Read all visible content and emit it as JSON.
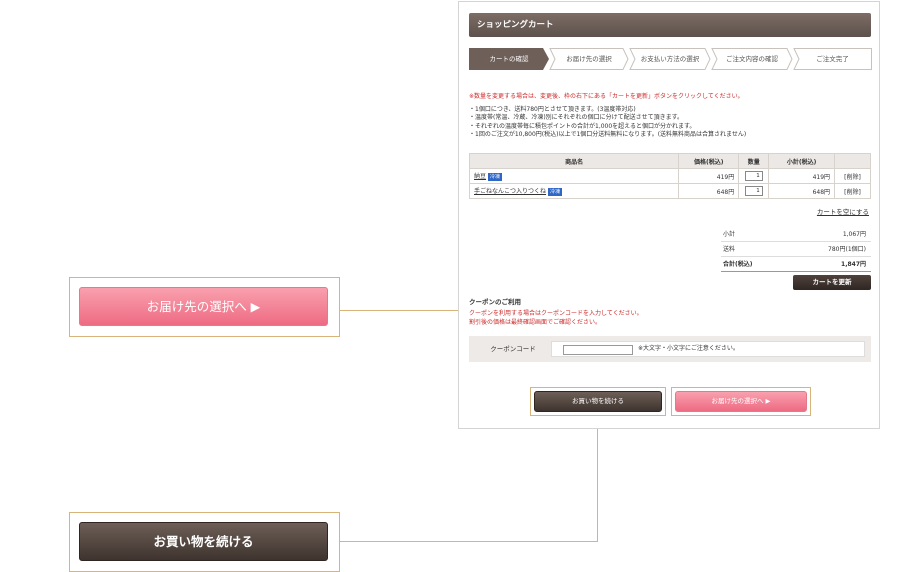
{
  "panel": {
    "title": "ショッピングカート",
    "steps": [
      "カートの確認",
      "お届け先の選択",
      "お支払い方法の選択",
      "ご注文内容の確認",
      "ご注文完了"
    ],
    "notice_red": "※数量を変更する場合は、変更後、枠の右下にある「カートを更新」ボタンをクリックしてください。",
    "notes": [
      "・1個口につき、送料780円とさせて頂きます。(3温度帯対応)",
      "・温度帯(常温、冷蔵、冷凍)別にそれぞれの個口に分けて配送させて頂きます。",
      "・それぞれの温度帯毎に積包ポイントの合計が1,000を超えると個口が分かれます。",
      "・1回のご注文が10,800円(税込)以上で1個口分送料無料になります。(送料無料商品は合算されません)"
    ],
    "table": {
      "headers": [
        "商品名",
        "価格(税込)",
        "数量",
        "小計(税込)",
        ""
      ],
      "rows": [
        {
          "name": "納豆",
          "badge": "冷凍",
          "price": "419円",
          "qty": "1",
          "subtotal": "419円",
          "action": "[削除]"
        },
        {
          "name": "手ごねなんこつ入りつくね",
          "badge": "冷凍",
          "price": "648円",
          "qty": "1",
          "subtotal": "648円",
          "action": "[削除]"
        }
      ]
    },
    "empty_cart": "カートを空にする",
    "summary": {
      "subtotal_label": "小計",
      "subtotal_value": "1,067円",
      "shipping_label": "送料",
      "shipping_value": "780円(1個口)",
      "total_label": "合計(税込)",
      "total_value": "1,847円"
    },
    "update_button": "カートを更新",
    "coupon": {
      "title": "クーポンのご利用",
      "red_lines": [
        "クーポンを利用する場合はクーポンコードを入力してください。",
        "割引後の価格は最終確認画面でご確認ください。"
      ],
      "label": "クーポンコード",
      "input_value": "",
      "hint": "※大文字・小文字にご注意ください。"
    },
    "continue_button": "お買い物を続ける",
    "next_button": "お届け先の選択へ ▶"
  },
  "callouts": {
    "next_button": "お届け先の選択へ ▶",
    "continue_button": "お買い物を続ける"
  },
  "colors": {
    "brand_dark": "#4f423c",
    "accent_pink": "#ee6b83",
    "notice_red": "#cc2b2b",
    "callout_line": "#d9b47a"
  }
}
